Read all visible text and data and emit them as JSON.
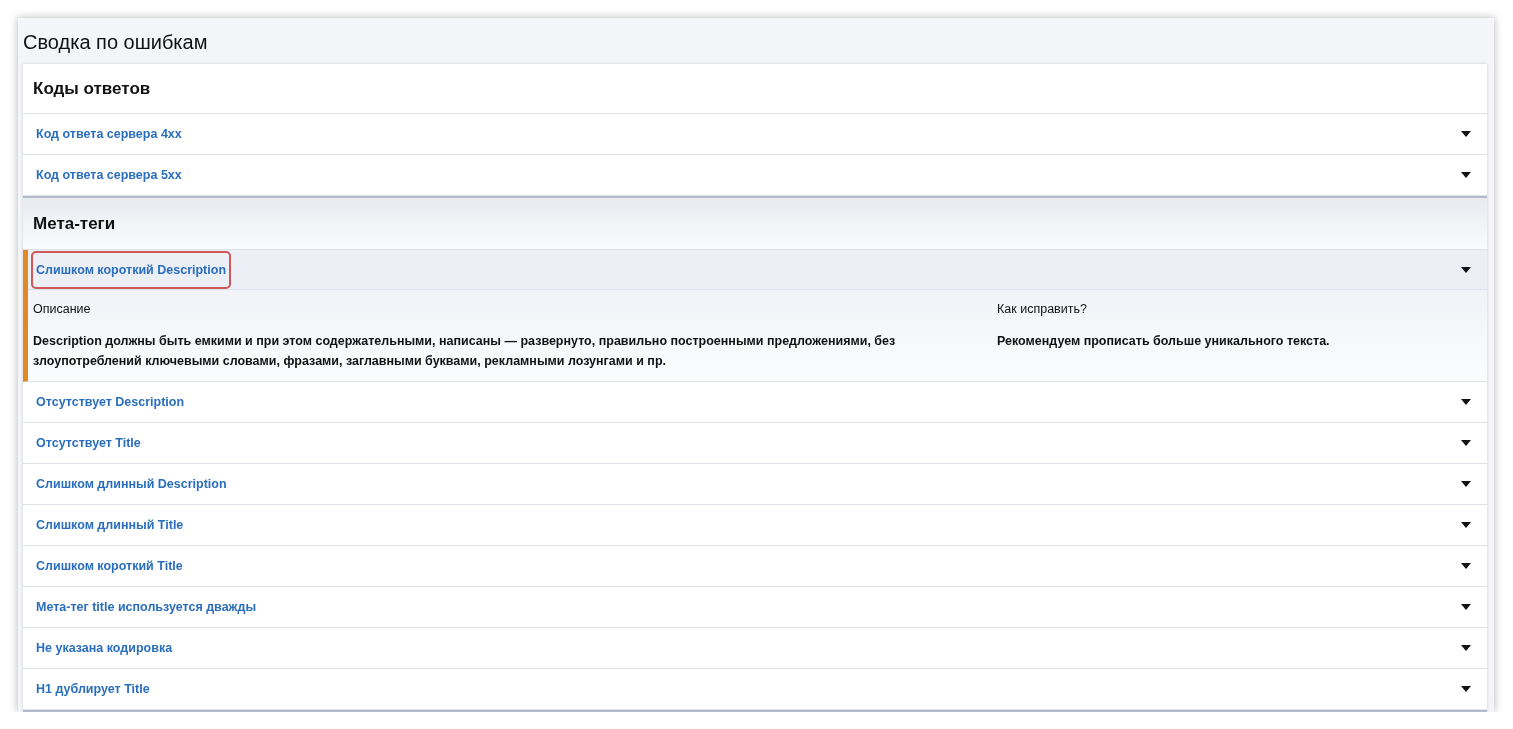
{
  "title": "Сводка по ошибкам",
  "sections": [
    {
      "title": "Коды ответов",
      "items": [
        {
          "label": "Код ответа сервера 4xx",
          "expanded": false,
          "highlighted": false
        },
        {
          "label": "Код ответа сервера 5xx",
          "expanded": false,
          "highlighted": false
        }
      ]
    },
    {
      "title": "Мета-теги",
      "items": [
        {
          "label": "Слишком короткий Description",
          "expanded": true,
          "highlighted": true,
          "description_label": "Описание",
          "description": "Description должны быть емкими и при этом содержательными, написаны — развернуто, правильно построенными предложениями, без злоупотреблений ключевыми словами, фразами, заглавными буквами, рекламными лозунгами и пр.",
          "fix_label": "Как исправить?",
          "fix": "Рекомендуем прописать больше уникального текста."
        },
        {
          "label": "Отсутствует Description",
          "expanded": false,
          "highlighted": false
        },
        {
          "label": "Отсутствует Title",
          "expanded": false,
          "highlighted": false
        },
        {
          "label": "Слишком длинный Description",
          "expanded": false,
          "highlighted": false
        },
        {
          "label": "Слишком длинный Title",
          "expanded": false,
          "highlighted": false
        },
        {
          "label": "Слишком короткий Title",
          "expanded": false,
          "highlighted": false
        },
        {
          "label": "Мета-тег title используется дважды",
          "expanded": false,
          "highlighted": false
        },
        {
          "label": "Не указана кодировка",
          "expanded": false,
          "highlighted": false
        },
        {
          "label": "H1 дублирует Title",
          "expanded": false,
          "highlighted": false
        }
      ]
    }
  ]
}
